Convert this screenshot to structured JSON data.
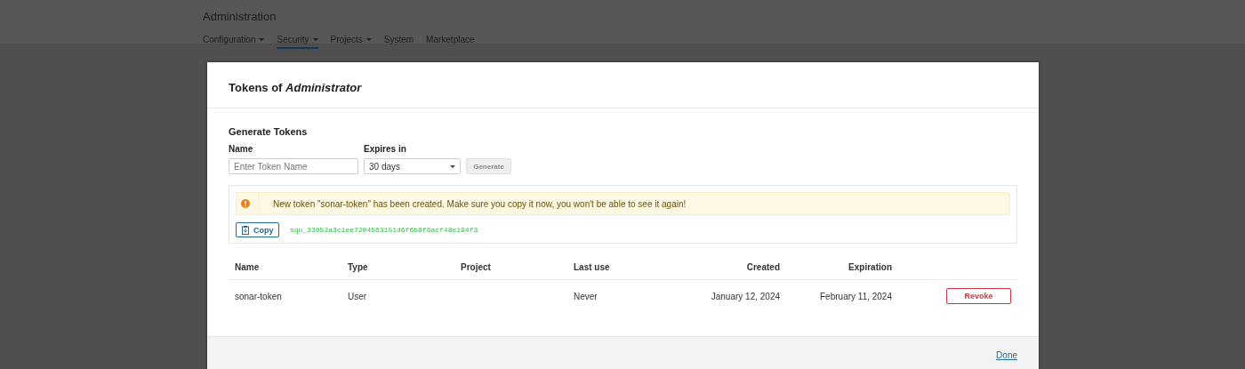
{
  "admin_header": {
    "title": "Administration",
    "nav": [
      {
        "label": "Configuration",
        "dropdown": true,
        "selected": false
      },
      {
        "label": "Security",
        "dropdown": true,
        "selected": true
      },
      {
        "label": "Projects",
        "dropdown": true,
        "selected": false
      },
      {
        "label": "System",
        "dropdown": false,
        "selected": false
      },
      {
        "label": "Marketplace",
        "dropdown": false,
        "selected": false
      }
    ]
  },
  "modal": {
    "title": "Tokens of *Administrator*",
    "generate": {
      "heading": "Generate Tokens",
      "name_label": "Name",
      "name_placeholder": "Enter Token Name",
      "expires_label": "Expires in",
      "expires_value": "30 days",
      "button": {
        "label": "Generate",
        "disabled": true
      }
    },
    "alert": {
      "message": "New token \"sonar-token\" has been created. Make sure you copy it now, you won't be able to see it again!",
      "copy_label": "Copy",
      "token": "squ_33052a3c1ee7204563151d6f6b8f6acf48e194f3"
    },
    "table": {
      "columns": [
        "Name",
        "Type",
        "Project",
        "Last use",
        "Created",
        "Expiration"
      ],
      "rows": [
        {
          "name": "sonar-token",
          "type": "User",
          "last_use": "Never",
          "created": "January 12, 2024",
          "expiration": "February 11, 2024",
          "action": "Revoke"
        }
      ]
    },
    "footer": {
      "done": "Done"
    }
  }
}
